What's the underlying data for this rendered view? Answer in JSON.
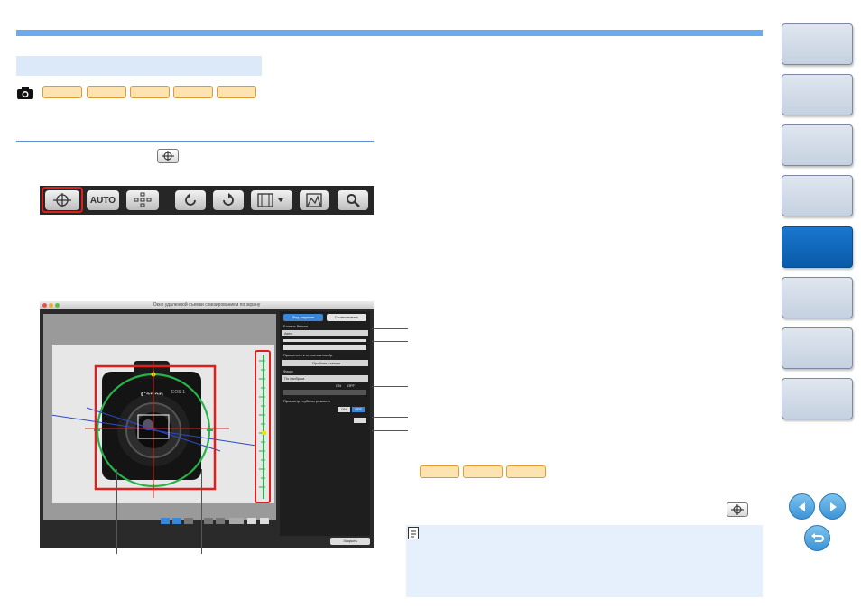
{
  "camera_window": {
    "title": "Окно удаленной съемки с визированием по экрану",
    "tabs": [
      "Фод-видение",
      "Скомпоновать"
    ],
    "white_balance_label": "Баланс белого",
    "wb_value": "Авто",
    "apply_checkbox_label": "Применить к отснятым изобр.",
    "test_shot_button": "Пробная съемка",
    "focus_label": "Фокус",
    "focus_value": "По изобрам.",
    "on_label": "ON",
    "off_label": "OFF",
    "dof_label": "Просмотр глубины резкости",
    "close_button": "Закрыть",
    "toolbar_auto": "AUTO",
    "lens_brand": "Canon",
    "body_model": "EOS-1"
  },
  "colors": {
    "accent_blue": "#6aaaf0",
    "chip_fill": "#fde3b0",
    "chip_border": "#e09a33",
    "highlight_red": "#e01e1e",
    "level_green": "#27b34a",
    "active_tab": "#0a5aa8"
  },
  "icons": {
    "camera": "camera-icon",
    "crosshair": "crosshair-icon",
    "note": "note-icon",
    "prev": "arrow-left-icon",
    "next": "arrow-right-icon",
    "back": "return-icon"
  }
}
